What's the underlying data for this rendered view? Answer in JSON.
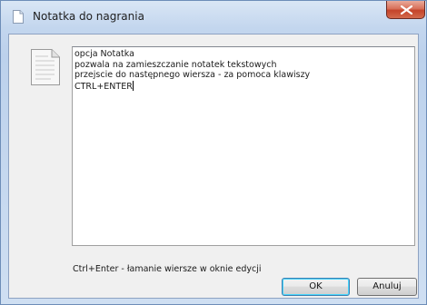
{
  "window": {
    "title": "Notatka do nagrania",
    "close_label": "close"
  },
  "editor": {
    "lines": [
      "opcja Notatka",
      "pozwala na zamieszczanie notatek tekstowych",
      "przejscie do następnego wiersza - za pomoca klawiszy",
      "CTRL+ENTER"
    ]
  },
  "hint": "Ctrl+Enter - łamanie wiersze w oknie edycji",
  "buttons": {
    "ok": "OK",
    "cancel": "Anuluj"
  },
  "icons": {
    "title": "document-icon",
    "note": "note-document-icon",
    "close": "close-icon"
  },
  "colors": {
    "close_button": "#c4432a",
    "frame": "#bcd1ec",
    "default_button_border": "#3c7fb1"
  }
}
